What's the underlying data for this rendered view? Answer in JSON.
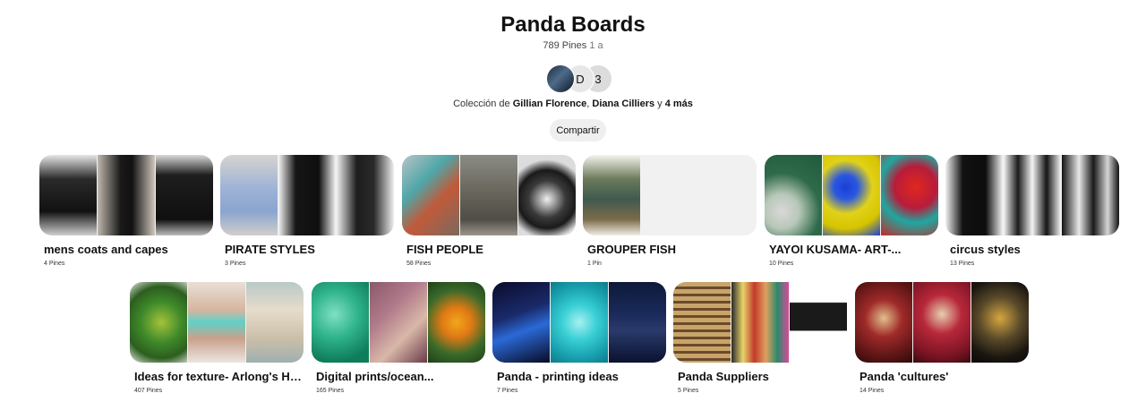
{
  "title": "Panda Boards",
  "stats": {
    "pins": "789 Pines",
    "followers": "1 a"
  },
  "avatars": [
    {
      "kind": "photo"
    },
    {
      "letter": "D"
    },
    {
      "letter": "3"
    }
  ],
  "collaboration": {
    "prefix": "Colección de",
    "user1": "Gillian Florence",
    "user2": "Diana Cilliers",
    "joiner": "y",
    "more": "4 más"
  },
  "share_button": "Compartir",
  "boards_row1": [
    {
      "name": "mens coats and capes",
      "count": "4 Pines"
    },
    {
      "name": "PIRATE STYLES",
      "count": "3 Pines"
    },
    {
      "name": "FISH PEOPLE",
      "count": "58 Pines"
    },
    {
      "name": "GROUPER FISH",
      "count": "1 Pin"
    },
    {
      "name": "YAYOI KUSAMA- ART-...",
      "count": "10 Pines"
    },
    {
      "name": "circus styles",
      "count": "13 Pines"
    }
  ],
  "boards_row2": [
    {
      "name": "Ideas for texture- Arlong's Hal...",
      "count": "407 Pines"
    },
    {
      "name": "Digital prints/ocean...",
      "count": "165 Pines"
    },
    {
      "name": "Panda - printing ideas",
      "count": "7 Pines"
    },
    {
      "name": "Panda Suppliers",
      "count": "5 Pines"
    },
    {
      "name": "Panda 'cultures'",
      "count": "14 Pines"
    }
  ]
}
